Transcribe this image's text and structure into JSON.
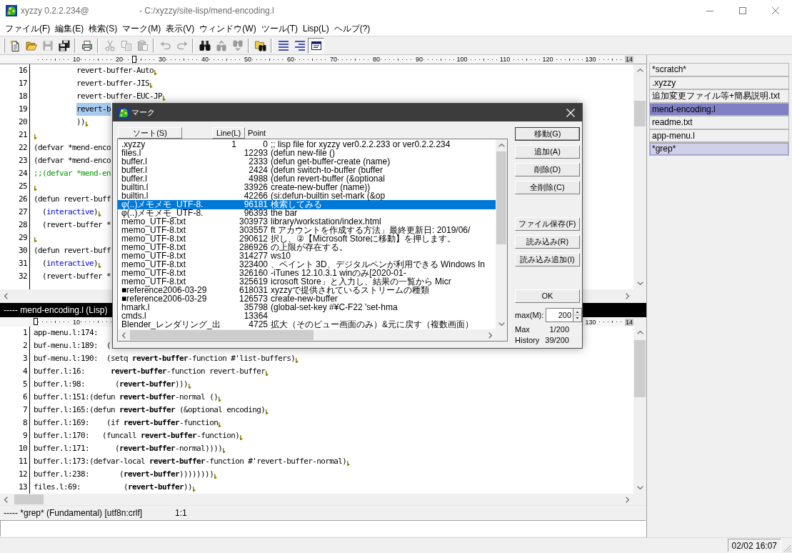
{
  "window": {
    "title": "xyzzy 0.2.2.234@",
    "path": "- C:/xyzzy/site-lisp/mend-encoding.l"
  },
  "menu": [
    "ファイル(F)",
    "編集(E)",
    "検索(S)",
    "マーク(M)",
    "表示(V)",
    "ウィンドウ(W)",
    "ツール(T)",
    "Lisp(L)",
    "ヘルプ(?)"
  ],
  "toolbar": [
    {
      "buttons": [
        {
          "disabled": false,
          "pressed": false
        },
        {
          "disabled": false,
          "pressed": false
        },
        {
          "disabled": true,
          "pressed": false
        },
        {
          "disabled": false,
          "pressed": false
        }
      ]
    },
    {
      "buttons": [
        {
          "disabled": false,
          "pressed": false
        }
      ]
    },
    {
      "buttons": [
        {
          "disabled": true,
          "pressed": false
        },
        {
          "disabled": true,
          "pressed": false
        },
        {
          "disabled": true,
          "pressed": false
        }
      ]
    },
    {
      "buttons": [
        {
          "disabled": true,
          "pressed": false
        },
        {
          "disabled": true,
          "pressed": false
        }
      ]
    },
    {
      "buttons": [
        {
          "disabled": false,
          "pressed": false
        },
        {
          "disabled": true,
          "pressed": false
        },
        {
          "disabled": true,
          "pressed": false
        }
      ]
    },
    {
      "buttons": [
        {
          "disabled": false,
          "pressed": false
        }
      ]
    },
    {
      "buttons": [
        {
          "disabled": false,
          "pressed": false
        },
        {
          "disabled": false,
          "pressed": false
        },
        {
          "disabled": false,
          "pressed": true
        }
      ]
    }
  ],
  "upper_editor": {
    "ruler": {
      "start": [
        "10",
        "20",
        "30",
        "40",
        "50",
        "60",
        "70",
        "80",
        "90",
        "100",
        "110",
        "120",
        "130",
        "14"
      ]
    },
    "lines": [
      {
        "number": "16",
        "parts": [
          {
            "kind": "plain",
            "text": "          revert-buffer-Auto"
          }
        ],
        "eol": true
      },
      {
        "number": "17",
        "parts": [
          {
            "kind": "plain",
            "text": "          revert-buffer-JIS"
          }
        ],
        "eol": true
      },
      {
        "number": "18",
        "parts": [
          {
            "kind": "plain",
            "text": "          revert-buffer-EUC-JP"
          }
        ],
        "eol": true
      },
      {
        "number": "19",
        "parts": [
          {
            "kind": "region",
            "text": "          revert-b"
          }
        ],
        "eol": false
      },
      {
        "number": "20",
        "parts": [
          {
            "kind": "plain",
            "text": "          ))"
          }
        ],
        "eol": true
      },
      {
        "number": "21",
        "eol": true
      },
      {
        "number": "22",
        "parts": [
          {
            "kind": "plain",
            "text": "(defvar *mend-enco"
          }
        ],
        "eol": false
      },
      {
        "number": "23",
        "parts": [
          {
            "kind": "plain",
            "text": "(defvar *mend-enco"
          }
        ],
        "eol": false
      },
      {
        "number": "24",
        "parts": [
          {
            "kind": "comment",
            "text": ";;(defvar *mend-en"
          }
        ],
        "eol": false
      },
      {
        "number": "25",
        "eol": true
      },
      {
        "number": "26",
        "parts": [
          {
            "kind": "plain",
            "text": "(defun revert-buff"
          }
        ],
        "eol": false
      },
      {
        "number": "27",
        "parts": [
          {
            "kind": "plain",
            "text": "  ("
          },
          {
            "kind": "keyword",
            "text": "interactive"
          },
          {
            "kind": "plain",
            "text": ")"
          }
        ],
        "eol": true
      },
      {
        "number": "28",
        "parts": [
          {
            "kind": "plain",
            "text": "  (revert-buffer *"
          }
        ],
        "eol": false
      },
      {
        "number": "29",
        "eol": true
      },
      {
        "number": "30",
        "parts": [
          {
            "kind": "plain",
            "text": "(defun revert-buff"
          }
        ],
        "eol": false
      },
      {
        "number": "31",
        "parts": [
          {
            "kind": "plain",
            "text": "  ("
          },
          {
            "kind": "keyword",
            "text": "interactive"
          },
          {
            "kind": "plain",
            "text": ")"
          }
        ],
        "eol": true
      },
      {
        "number": "32",
        "parts": [
          {
            "kind": "plain",
            "text": "  (revert-buffer *"
          }
        ],
        "eol": false
      }
    ]
  },
  "mode_line": "----- mend-encoding.l (Lisp)",
  "lower_editor": {
    "ruler": {
      "start": [
        "10"
      ],
      "end": [
        "130",
        "14"
      ]
    },
    "lines": [
      {
        "number": "1",
        "text": "app-menu.l:174:",
        "eol": false
      },
      {
        "number": "2",
        "text": "buf-menu.l:189:  (",
        "eol": false
      },
      {
        "number": "3",
        "text": "buf-menu.l:190:  (setq **revert-buffer**-function #'list-buffers)",
        "eol": true
      },
      {
        "number": "4",
        "text": "buffer.l:16:      **revert-buffer**-function revert-buffer",
        "eol": true
      },
      {
        "number": "5",
        "text": "buffer.l:98:       (**revert-buffer**)))",
        "eol": true
      },
      {
        "number": "6",
        "text": "buffer.l:151:(defun **revert-buffer**-normal ()",
        "eol": true
      },
      {
        "number": "7",
        "text": "buffer.l:165:(defun **revert-buffer** (&optional encoding)",
        "eol": true
      },
      {
        "number": "8",
        "text": "buffer.l:169:    (if **revert-buffer**-function",
        "eol": true
      },
      {
        "number": "9",
        "text": "buffer.l:170:   (funcall **revert-buffer**-function)",
        "eol": true
      },
      {
        "number": "10",
        "text": "buffer.l:171:      (**revert-buffer**-normal))))",
        "eol": true
      },
      {
        "number": "11",
        "text": "buffer.l:173:(defvar-local **revert-buffer**-function #'revert-buffer-normal)",
        "eol": true
      },
      {
        "number": "12",
        "text": "buffer.l:238:       (**revert-buffer**))))))))",
        "eol": true
      },
      {
        "number": "13",
        "text": "files.l:69:          (**revert-buffer**))",
        "eol": true
      }
    ]
  },
  "status_line": {
    "buffer": "----- *grep* (Fundamental) [utf8n:crlf]",
    "position": "1:1"
  },
  "sidebar": {
    "buffers": [
      {
        "name": "*scratch*",
        "selected": false,
        "shown": false
      },
      {
        "name": ".xyzzy",
        "selected": false,
        "shown": false
      },
      {
        "name": "追加変更ファイル等+簡易説明.txt",
        "selected": false,
        "shown": false
      },
      {
        "name": "mend-encoding.l",
        "selected": true,
        "shown": false
      },
      {
        "name": "readme.txt",
        "selected": false,
        "shown": false
      },
      {
        "name": "app-menu.l",
        "selected": false,
        "shown": false
      },
      {
        "name": "*grep*",
        "selected": false,
        "shown": true
      }
    ]
  },
  "status_bar": {
    "clock": "02/02 16:07"
  },
  "dialog": {
    "title": "マーク",
    "sort_button": "ソート(S)",
    "line_button": "Line(L)",
    "point_label": "Point",
    "rows": [
      {
        "buffer": ".xyzzy",
        "line": "1",
        "point": "0",
        "text": ";; lisp file for xyzzy ver0.2.2.233 or ver0.2.2.234",
        "selected": false
      },
      {
        "buffer": "files.l",
        "point": "12293",
        "text": "(defun new-file ()",
        "selected": false
      },
      {
        "buffer": "buffer.l",
        "point": "2333",
        "text": "(defun get-buffer-create (name)",
        "selected": false
      },
      {
        "buffer": "buffer.l",
        "point": "2424",
        "text": "(defun switch-to-buffer (buffer",
        "selected": false
      },
      {
        "buffer": "buffer.l",
        "point": "4988",
        "text": "(defun revert-buffer (&optional",
        "selected": false
      },
      {
        "buffer": "builtin.l",
        "point": "33926",
        "text": "create-new-buffer (name))",
        "selected": false
      },
      {
        "buffer": "builtin.l",
        "point": "42266",
        "text": "(si:defun-builtin set-mark (&op",
        "selected": false
      },
      {
        "buffer": "φ(..)メモメモ_UTF-8.",
        "point": "96181",
        "text": "検索してみる",
        "selected": true
      },
      {
        "buffer": "φ(..)メモメモ_UTF-8.",
        "point": "96393",
        "text": "the bar",
        "selected": false
      },
      {
        "buffer": "memo_UTF-8.txt",
        "point": "303973",
        "text": "library/workstation/index.html",
        "selected": false
      },
      {
        "buffer": "memo_UTF-8.txt",
        "point": "303557",
        "text": "ft アカウントを作成する方法」最終更新日: 2019/06/",
        "selected": false
      },
      {
        "buffer": "memo_UTF-8.txt",
        "point": "290612",
        "text": "択し、②【Microsoft Storeに移動】を押します。",
        "selected": false
      },
      {
        "buffer": "memo_UTF-8.txt",
        "point": "286926",
        "text": "の上限が存在する。",
        "selected": false
      },
      {
        "buffer": "memo_UTF-8.txt",
        "point": "314277",
        "text": "ws10",
        "selected": false
      },
      {
        "buffer": "memo_UTF-8.txt",
        "point": "323400",
        "text": "、ペイント 3D、デジタルペンが利用できる Windows In",
        "selected": false
      },
      {
        "buffer": "memo_UTF-8.txt",
        "point": "326160",
        "text": "-iTunes 12.10.3.1 winのみ[2020-01-",
        "selected": false
      },
      {
        "buffer": "memo_UTF-8.txt",
        "point": "325619",
        "text": "icrosoft Store」と入力し、結果の一覧から Micr",
        "selected": false
      },
      {
        "buffer": "■reference2006-03-29",
        "point": "618031",
        "text": "xyzzyで提供されているストリームの種類",
        "selected": false
      },
      {
        "buffer": "■reference2006-03-29",
        "point": "126573",
        "text": "create-new-buffer",
        "selected": false
      },
      {
        "buffer": "hmark.l",
        "point": "35798",
        "text": "(global-set-key #¥C-F22 'set-hma",
        "selected": false
      },
      {
        "buffer": "cmds.l",
        "point": "13364",
        "selected": false
      },
      {
        "buffer": "Blender_レンダリング_出",
        "point": "4725",
        "text": "拡大（そのビュー画面のみ）&元に戻す（複数画面）",
        "selected": false
      }
    ],
    "button_groups": [
      {
        "buttons": [
          {
            "label": "移動(G)",
            "default": true
          },
          {
            "label": "追加(A)",
            "default": false
          },
          {
            "label": "削除(D)",
            "default": false
          },
          {
            "label": "全削除(C)",
            "default": false
          }
        ]
      },
      {
        "buttons": [
          {
            "label": "ファイル保存(F)",
            "default": false
          },
          {
            "label": "読み込み(R)",
            "default": false
          },
          {
            "label": "読み込み追加(I)",
            "default": false
          }
        ]
      },
      {
        "buttons": [
          {
            "label": "OK",
            "default": false
          }
        ]
      }
    ],
    "max_label": "max(M):",
    "max_value": "200",
    "stats": [
      {
        "label": "Max",
        "value": "1/200"
      },
      {
        "label": "History",
        "value": "39/200"
      }
    ]
  }
}
